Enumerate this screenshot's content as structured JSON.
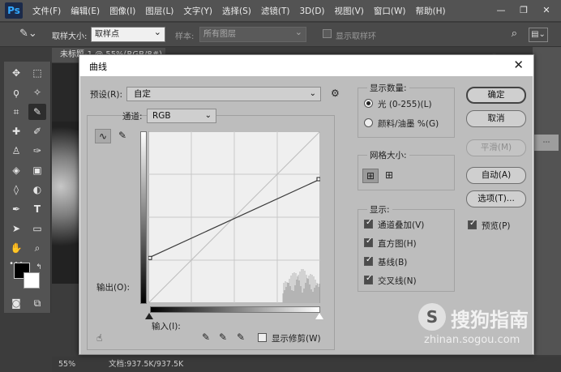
{
  "app": {
    "logo": "Ps",
    "menu": [
      "文件(F)",
      "编辑(E)",
      "图像(I)",
      "图层(L)",
      "文字(Y)",
      "选择(S)",
      "滤镜(T)",
      "3D(D)",
      "视图(V)",
      "窗口(W)",
      "帮助(H)"
    ],
    "window_controls": [
      "—",
      "❐",
      "✕"
    ]
  },
  "options_bar": {
    "sample_size_label": "取样大小:",
    "sample_size_value": "取样点",
    "sample_label": "样本:",
    "sample_value": "所有图层",
    "show_ring_label": "显示取样环"
  },
  "document": {
    "tab_title": "未标题-1 @ 55%(RGB/8#) ×",
    "zoom": "55%",
    "doc_size": "文档:937.5K/937.5K"
  },
  "dialog": {
    "title": "曲线",
    "close": "✕",
    "preset_label": "预设(R):",
    "preset_value": "自定",
    "channel_label": "通道:",
    "channel_value": "RGB",
    "output_label": "输出(O):",
    "input_label": "输入(I):",
    "show_clipping_label": "显示修剪(W)",
    "show_amount": {
      "legend": "显示数量:",
      "options": [
        {
          "label": "光 (0-255)(L)",
          "selected": true
        },
        {
          "label": "颜料/油墨 %(G)",
          "selected": false
        }
      ]
    },
    "grid_size": {
      "legend": "网格大小:"
    },
    "show": {
      "legend": "显示:",
      "options": [
        {
          "label": "通道叠加(V)",
          "checked": true
        },
        {
          "label": "直方图(H)",
          "checked": true
        },
        {
          "label": "基线(B)",
          "checked": true
        },
        {
          "label": "交叉线(N)",
          "checked": true
        }
      ]
    },
    "buttons": {
      "ok": "确定",
      "cancel": "取消",
      "smooth": "平滑(M)",
      "auto": "自动(A)",
      "options": "选项(T)..."
    },
    "preview_label": "预览(P)",
    "curve_points": [
      [
        0,
        67
      ],
      [
        255,
        184
      ]
    ]
  },
  "watermark": {
    "logo": "S",
    "text": "搜狗指南",
    "url": "zhinan.sogou.com"
  },
  "colors": {
    "dialog_body": "#bdbdbd",
    "chrome": "#535353"
  }
}
